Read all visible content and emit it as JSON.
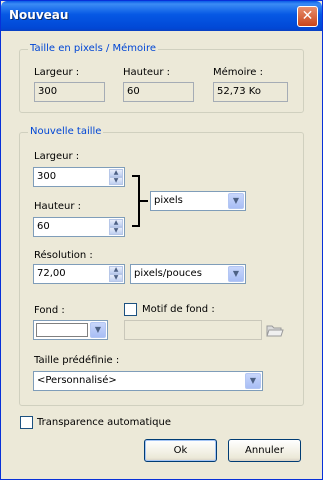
{
  "window": {
    "title": "Nouveau",
    "close": "✕"
  },
  "memory_group": {
    "title": "Taille en pixels / Mémoire",
    "width_label": "Largeur :",
    "width_value": "300",
    "height_label": "Hauteur :",
    "height_value": "60",
    "memory_label": "Mémoire :",
    "memory_value": "52,73 Ko"
  },
  "size_group": {
    "title": "Nouvelle taille",
    "width_label": "Largeur :",
    "width_value": "300",
    "height_label": "Hauteur :",
    "height_value": "60",
    "unit_value": "pixels",
    "resolution_label": "Résolution :",
    "resolution_value": "72,00",
    "resolution_unit_value": "pixels/pouces",
    "background_label": "Fond :",
    "background_color": "#ffffff",
    "pattern_label": "Motif de fond :",
    "pattern_value": "",
    "preset_label": "Taille prédéfinie :",
    "preset_value": "<Personnalisé>"
  },
  "transparency_label": "Transparence automatique",
  "buttons": {
    "ok": "Ok",
    "cancel": "Annuler"
  }
}
